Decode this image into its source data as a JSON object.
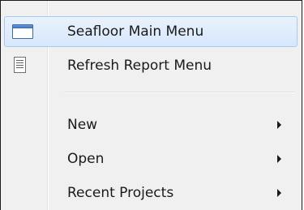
{
  "menu": {
    "items": [
      {
        "label": "Seafloor Main Menu",
        "icon": "window-icon",
        "highlighted": true
      },
      {
        "label": "Refresh Report Menu",
        "icon": "document-icon"
      },
      {
        "label": "New",
        "submenu": true
      },
      {
        "label": "Open",
        "submenu": true
      },
      {
        "label": "Recent Projects",
        "submenu": true
      }
    ]
  },
  "colors": {
    "highlight_border": "#a9c9f0",
    "highlight_fill": "#d6e7fb",
    "menu_background": "#f0f0f0",
    "text": "#1a1a1a"
  }
}
